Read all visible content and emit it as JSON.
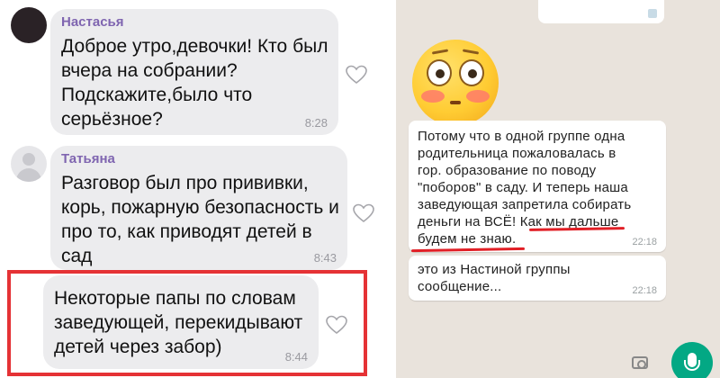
{
  "left_chat": {
    "messages": [
      {
        "sender": "Настасья",
        "text": "Доброе утро,девочки! Кто был\nвчера на собрании?\nПодскажите,было что\nсерьёзное?",
        "time": "8:28"
      },
      {
        "sender": "Татьяна",
        "text": "Разговор был про прививки,\nкорь, пожарную безопасность и\nпро то, как приводят детей в\nсад",
        "time": "8:43"
      },
      {
        "sender": "",
        "text": "Некоторые папы по словам\nзаведующей, перекидывают\nдетей через забор)",
        "time": "8:44"
      }
    ],
    "highlight_color": "#e53235"
  },
  "right_chat": {
    "emoji": "flushed-face",
    "messages": [
      {
        "text": "Потому что в одной группе одна\nродительница пожаловалась в\nгор. образование по поводу\n\"поборов\" в саду. И теперь наша\nзаведующая запретила собирать\nденьги на ВСЁ! Как мы дальше\nбудем не знаю.",
        "time": "22:18"
      },
      {
        "text": "это из Настиной группы\nсообщение...",
        "time": "22:18"
      }
    ],
    "underline_color": "#e11f26",
    "mic_button_color": "#03a884"
  }
}
